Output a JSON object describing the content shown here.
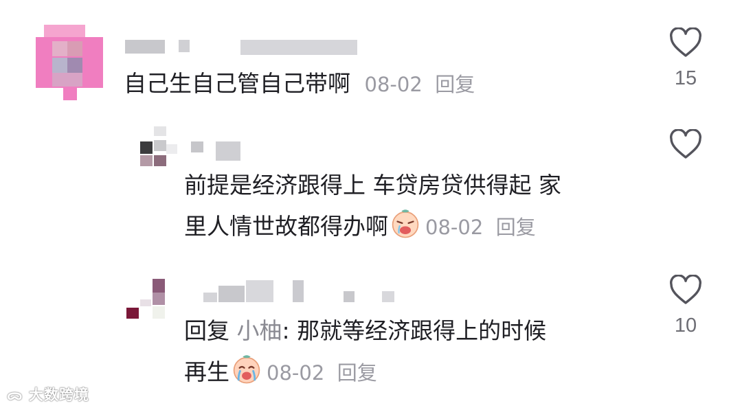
{
  "comments": [
    {
      "text": "自己生自己管自己带啊",
      "date": "08-02",
      "reply_label": "回复",
      "like_count": "15"
    },
    {
      "text_line1": "前提是经济跟得上 车贷房贷供得起 家",
      "text_line2": "里人情世故都得办啊",
      "emoji": "crying-face-emoji",
      "date": "08-02",
      "reply_label": "回复",
      "like_count": ""
    },
    {
      "prefix": "回复",
      "mention": "小柚",
      "text_line1": ": 那就等经济跟得上的时候",
      "text_line2": "再生",
      "emoji": "crying-face-emoji",
      "date": "08-02",
      "reply_label": "回复",
      "like_count": "10"
    }
  ],
  "watermark": "大数跨境",
  "icons": {
    "like": "heart-outline-icon"
  }
}
